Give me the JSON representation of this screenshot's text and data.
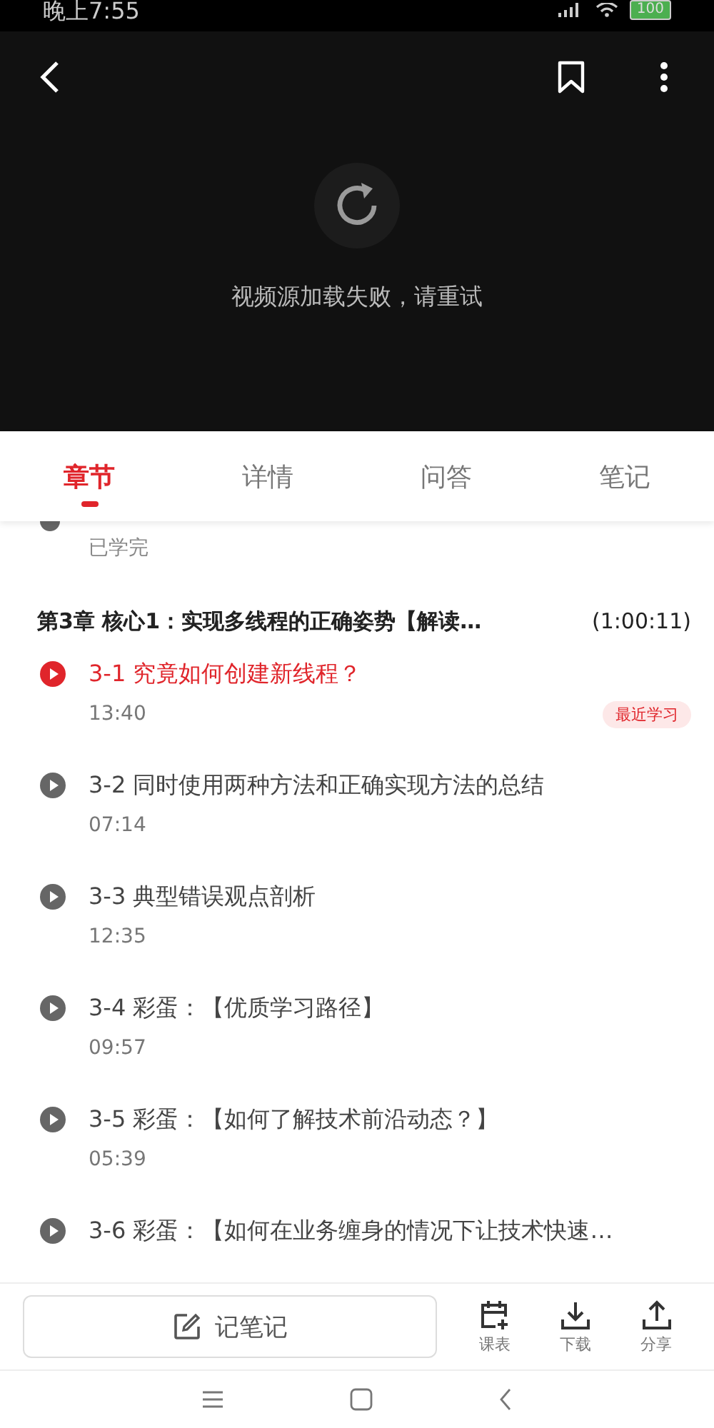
{
  "status_bar": {
    "time": "晚上7:55",
    "battery": "100"
  },
  "video": {
    "message": "视频源加载失败，请重试"
  },
  "tabs": [
    {
      "label": "章节",
      "selected": true
    },
    {
      "label": "详情",
      "selected": false
    },
    {
      "label": "问答",
      "selected": false
    },
    {
      "label": "笔记",
      "selected": false
    }
  ],
  "previous_lesson": {
    "status": "已学完"
  },
  "chapter": {
    "title": "第3章 核心1：实现多线程的正确姿势【解读…",
    "duration": "(1:00:11)"
  },
  "lessons": [
    {
      "title": "3-1 究竟如何创建新线程？",
      "duration": "13:40",
      "selected": true,
      "badge": "最近学习"
    },
    {
      "title": "3-2 同时使用两种方法和正确实现方法的总结",
      "duration": "07:14",
      "selected": false
    },
    {
      "title": "3-3 典型错误观点剖析",
      "duration": "12:35",
      "selected": false
    },
    {
      "title": "3-4 彩蛋：【优质学习路径】",
      "duration": "09:57",
      "selected": false
    },
    {
      "title": "3-5 彩蛋：【如何了解技术前沿动态？】",
      "duration": "05:39",
      "selected": false
    },
    {
      "title": "3-6 彩蛋：【如何在业务缠身的情况下让技术快速…",
      "selected": false
    }
  ],
  "bottom_bar": {
    "note_button": "记笔记",
    "actions": [
      {
        "kind": "schedule",
        "label": "课表"
      },
      {
        "kind": "download",
        "label": "下载"
      },
      {
        "kind": "share",
        "label": "分享"
      }
    ]
  }
}
